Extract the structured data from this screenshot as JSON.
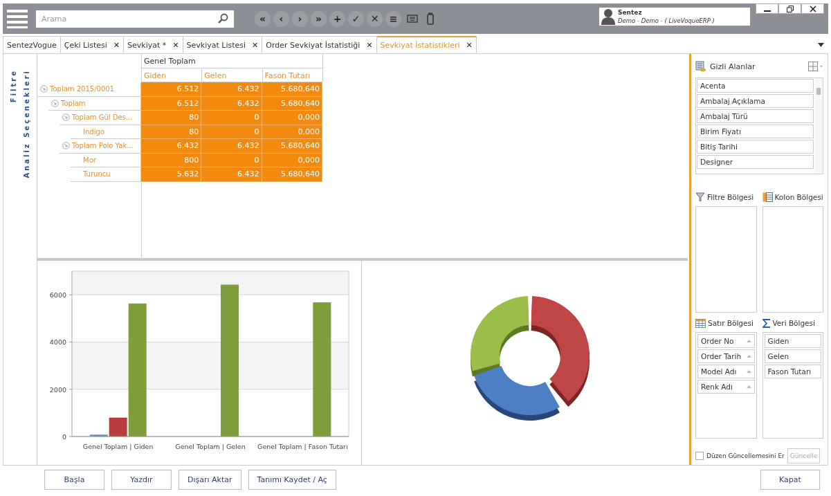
{
  "toolbar": {
    "search": {
      "placeholder": "Arama"
    },
    "nav_buttons": [
      "«",
      "‹",
      "›",
      "»",
      "+",
      "✓",
      "✕",
      "≡"
    ]
  },
  "user": {
    "name": "Sentez",
    "subtitle": "Demo - Demo - ( LiveVoqueERP )"
  },
  "tabs": [
    {
      "label": "SentezVogue",
      "selected": false,
      "closable": false
    },
    {
      "label": "Çeki Listesi",
      "selected": false,
      "closable": true
    },
    {
      "label": "Sevkiyat *",
      "selected": false,
      "closable": true
    },
    {
      "label": "Sevkiyat Listesi",
      "selected": false,
      "closable": true
    },
    {
      "label": "Order Sevkiyat İstatistiği",
      "selected": false,
      "closable": true
    },
    {
      "label": "Sevkiyat İstatistikleri",
      "selected": true,
      "closable": true
    }
  ],
  "tab_close_glyph": "✕",
  "side_labels": [
    "Filtre",
    "Analiz Seçenekleri"
  ],
  "pivot": {
    "column_group": "Genel Toplam",
    "columns": [
      "Giden",
      "Gelen",
      "Fason Tutarı"
    ],
    "rows": [
      {
        "label": "Toplam 2015/0001",
        "values": [
          "6.512",
          "6.432",
          "5.680,640"
        ],
        "children": [
          {
            "label": "Toplam",
            "values": [
              "6.512",
              "6.432",
              "5.680,640"
            ],
            "children": [
              {
                "label": "Toplam Gül Des...",
                "values": [
                  "80",
                  "0",
                  "0,000"
                ],
                "children": [
                  {
                    "label": "Indigo",
                    "values": [
                      "80",
                      "0",
                      "0,000"
                    ]
                  }
                ]
              },
              {
                "label": "Toplam Polo Yak...",
                "values": [
                  "6.432",
                  "6.432",
                  "5.680,640"
                ],
                "children": [
                  {
                    "label": "Mor",
                    "values": [
                      "800",
                      "0",
                      "0,000"
                    ]
                  },
                  {
                    "label": "Turuncu",
                    "values": [
                      "5.632",
                      "6.432",
                      "5.680,640"
                    ]
                  }
                ]
              }
            ]
          }
        ]
      }
    ]
  },
  "chart_data": {
    "type": "bar",
    "categories": [
      "Genel Toplam | Giden",
      "Genel Toplam | Gelen",
      "Genel Toplam | Fason Tutarı"
    ],
    "series": [
      {
        "color": "#6f8db5",
        "values": [
          80,
          0,
          0
        ]
      },
      {
        "color": "#b83c3c",
        "values": [
          800,
          0,
          0
        ]
      },
      {
        "color": "#7e9e3c",
        "values": [
          5630,
          6430,
          5680
        ]
      }
    ],
    "grid": true,
    "ylim": [
      0,
      7000
    ],
    "yticks": [
      0,
      2000,
      4000,
      6000
    ]
  },
  "field_list": {
    "title": "Gizli Alanlar",
    "hidden_fields": [
      "Acenta",
      "Ambalaj Açıklama",
      "Ambalaj Türü",
      "Birim Fiyatı",
      "Bitiş Tarihi",
      "Designer"
    ],
    "filter_area": {
      "title": "Filtre Bölgesi"
    },
    "column_area": {
      "title": "Kolon Bölgesi"
    },
    "row_area": {
      "title": "Satır Bölgesi",
      "fields": [
        "Order No",
        "Order Tarih",
        "Model Adı",
        "Renk Adı"
      ]
    },
    "data_area": {
      "title": "Veri Bölgesi",
      "fields": [
        "Giden",
        "Gelen",
        "Fason Tutarı"
      ]
    },
    "defer_update": {
      "label": "Düzen Güncellemesini Er",
      "checked": false
    },
    "update_button": {
      "label": "Güncelle",
      "disabled": true
    }
  },
  "bottom_buttons": [
    "Başla",
    "Yazdır",
    "Dışarı Aktar",
    "Tanımı Kaydet / Aç"
  ],
  "close_button": "Kapat"
}
